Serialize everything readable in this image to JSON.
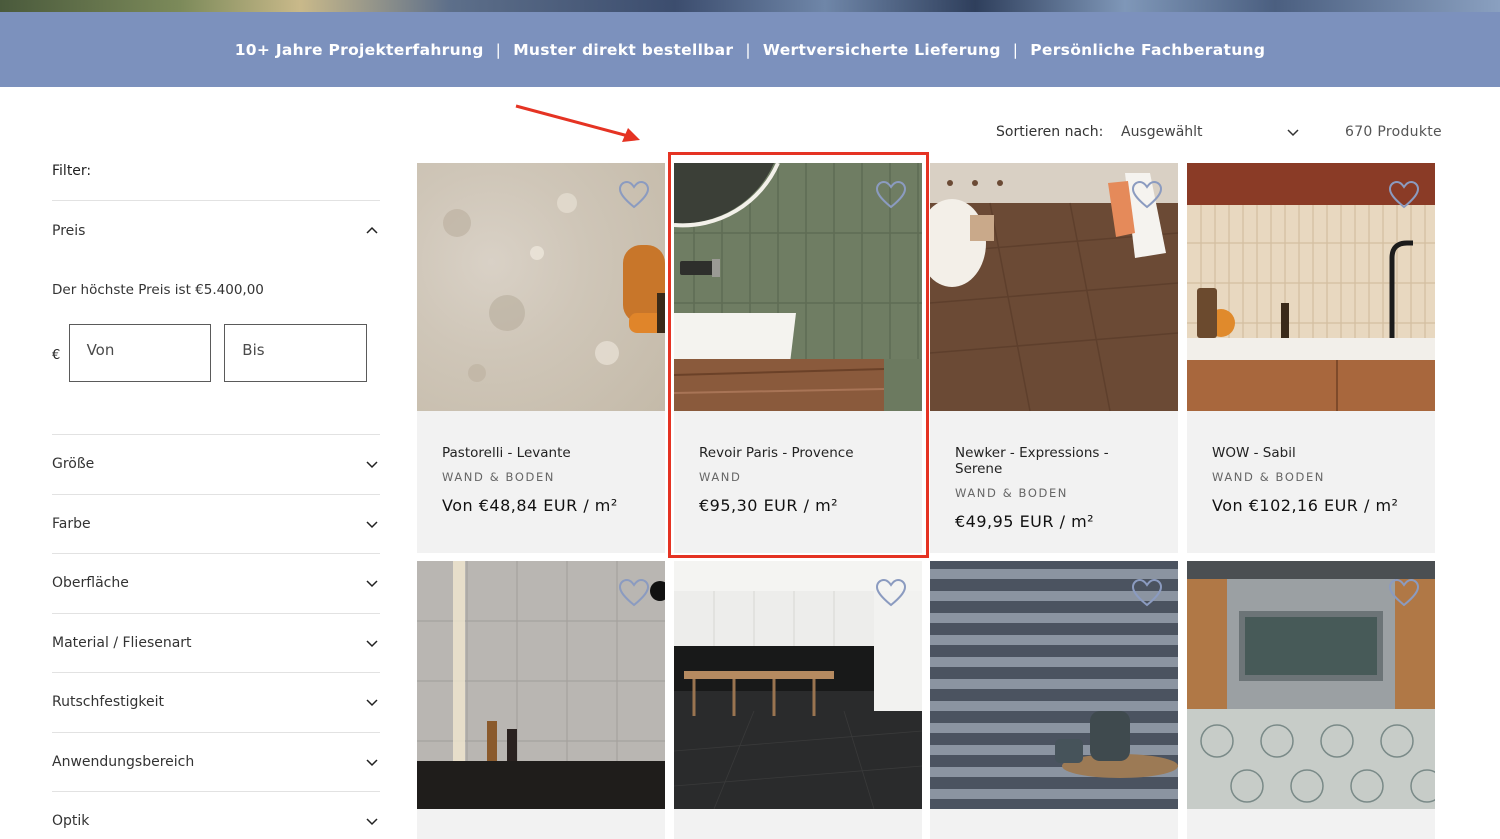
{
  "announcement": {
    "items": [
      "10+ Jahre Projekterfahrung",
      "Muster direkt bestellbar",
      "Wertversicherte Lieferung",
      "Persönliche Fachberatung"
    ],
    "separator": "|"
  },
  "filter": {
    "title": "Filter:",
    "price": {
      "label": "Preis",
      "note": "Der höchste Preis ist €5.400,00",
      "currency": "€",
      "from_placeholder": "Von",
      "to_placeholder": "Bis"
    },
    "facets": [
      "Größe",
      "Farbe",
      "Oberfläche",
      "Material / Fliesenart",
      "Rutschfestigkeit",
      "Anwendungsbereich",
      "Optik"
    ]
  },
  "sort": {
    "label": "Sortieren nach:",
    "selected": "Ausgewählt",
    "count": "670 Produkte"
  },
  "products": [
    {
      "name": "Pastorelli - Levante",
      "category": "WAND & BODEN",
      "price": "Von €48,84 EUR / m²",
      "image": "beige-terrazzo-floor-with-stool"
    },
    {
      "name": "Revoir Paris - Provence",
      "category": "WAND",
      "price": "€95,30 EUR / m²",
      "image": "green-tile-bathroom-with-basin"
    },
    {
      "name": "Newker - Expressions - Serene",
      "category": "WAND & BODEN",
      "price": "€49,95 EUR / m²",
      "image": "wood-parquet-floor-with-chair"
    },
    {
      "name": "WOW - Sabil",
      "category": "WAND & BODEN",
      "price": "Von €102,16 EUR / m²",
      "image": "cream-tile-kitchen-backsplash"
    },
    {
      "name": "",
      "category": "",
      "price": "",
      "image": "grey-stone-wall-tiles"
    },
    {
      "name": "",
      "category": "",
      "price": "",
      "image": "black-marble-floor-dining-room"
    },
    {
      "name": "",
      "category": "",
      "price": "",
      "image": "grey-3d-relief-wall-tiles"
    },
    {
      "name": "",
      "category": "",
      "price": "",
      "image": "patterned-cement-floor-kitchen"
    }
  ],
  "colors": {
    "announcement_bg": "#7c91bd",
    "highlight": "#e53323",
    "card_bg": "#f2f2f2"
  }
}
